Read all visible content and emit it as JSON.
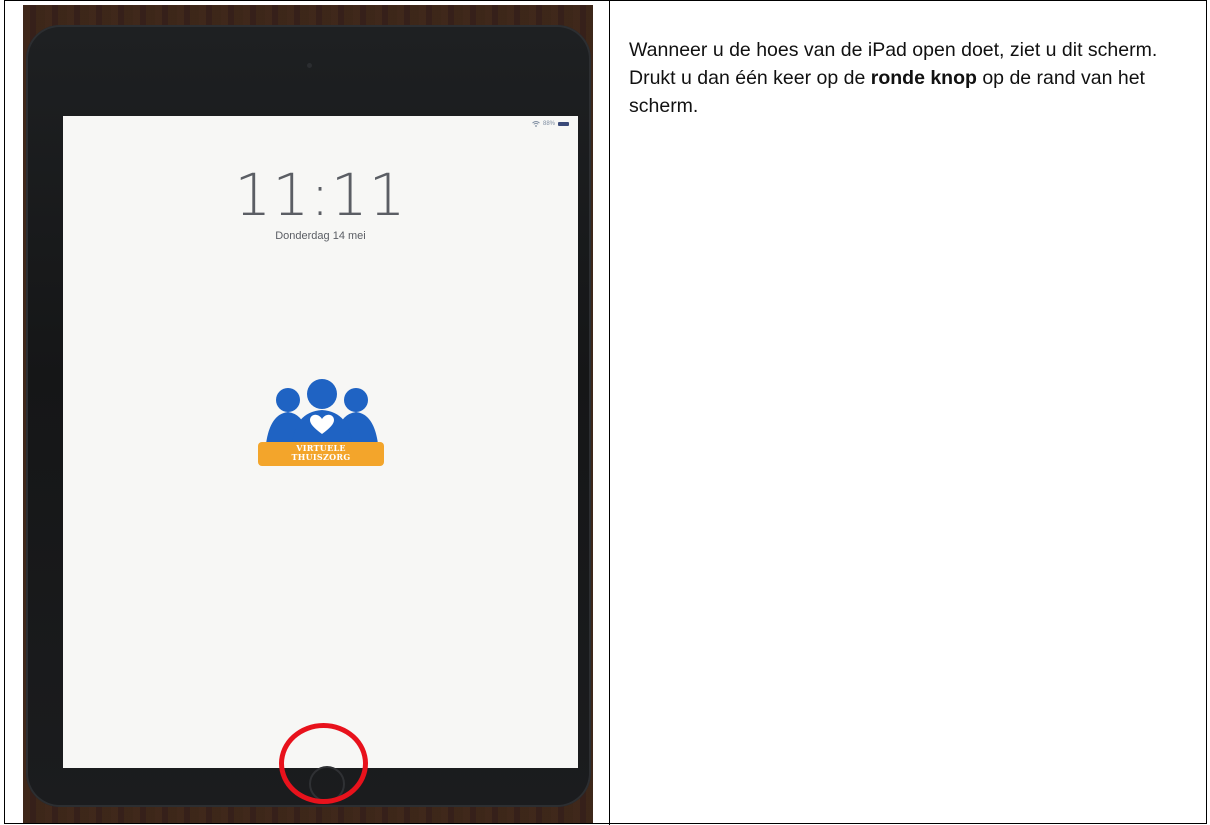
{
  "ipad_screen": {
    "battery_percent_text": "88%",
    "time": "11:11",
    "date": "Donderdag 14 mei",
    "logo": {
      "line1": "VIRTUELE",
      "line2": "THUISZORG",
      "colors": {
        "blue": "#1f63c3",
        "orange": "#f3a52b",
        "heart": "#ffffff"
      }
    }
  },
  "highlight": {
    "color": "#e8121c",
    "target": "home-button"
  },
  "instruction": {
    "paragraph1": "Wanneer u de hoes van de iPad open doet, ziet u dit scherm.",
    "paragraph2_before": "Drukt u dan één keer op de ",
    "paragraph2_bold": "ronde knop",
    "paragraph2_after": " op de rand van het scherm."
  }
}
